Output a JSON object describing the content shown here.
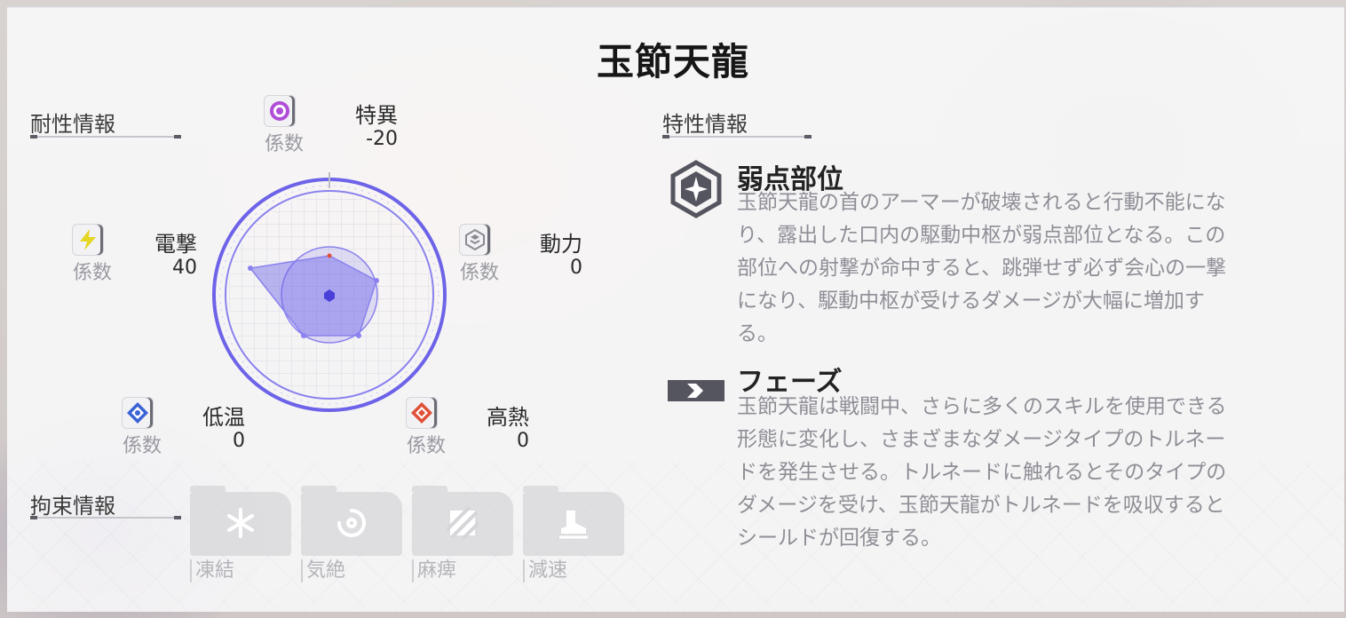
{
  "title": "玉節天龍",
  "resistance": {
    "header": "耐性情報",
    "coef_label": "係数",
    "stats": {
      "anomaly": {
        "name": "特異",
        "value": "-20",
        "icon": "anomaly-target-icon",
        "color": "#b04ed8"
      },
      "electric": {
        "name": "電撃",
        "value": "40",
        "icon": "lightning-icon",
        "color": "#e6d624"
      },
      "kinetic": {
        "name": "動力",
        "value": "0",
        "icon": "kinetic-cube-icon",
        "color": "#8a8a92"
      },
      "ice": {
        "name": "低温",
        "value": "0",
        "icon": "ice-crystal-icon",
        "color": "#3a63d6"
      },
      "fire": {
        "name": "高熱",
        "value": "0",
        "icon": "fire-diamond-icon",
        "color": "#e0513a"
      }
    },
    "radar_color": "#6d63e8"
  },
  "binding": {
    "header": "拘束情報",
    "items": [
      {
        "label": "凍結",
        "icon": "freeze-snowflake-icon"
      },
      {
        "label": "気絶",
        "icon": "stun-swirl-icon"
      },
      {
        "label": "麻痺",
        "icon": "paralysis-bolt-icon"
      },
      {
        "label": "減速",
        "icon": "slow-boot-icon"
      }
    ]
  },
  "traits": {
    "header": "特性情報",
    "items": [
      {
        "name": "弱点部位",
        "icon": "weak-point-hexagon-icon",
        "lines": [
          "玉節天龍の首のアーマーが破壊されると行動不能にな",
          "り、露出した口内の駆動中枢が弱点部位となる。この",
          "部位への射撃が命中すると、跳弾せず必ず会心の一撃",
          "になり、駆動中枢が受けるダメージが大幅に増加す",
          "る。"
        ]
      },
      {
        "name": "フェーズ",
        "icon": "phase-arrow-icon",
        "lines": [
          "玉節天龍は戦闘中、さらに多くのスキルを使用できる",
          "形態に変化し、さまざまなダメージタイプのトルネー",
          "ドを発生させる。トルネードに触れるとそのタイプの",
          "ダメージを受け、玉節天龍がトルネードを吸収すると",
          "シールドが回復する。"
        ]
      }
    ]
  }
}
